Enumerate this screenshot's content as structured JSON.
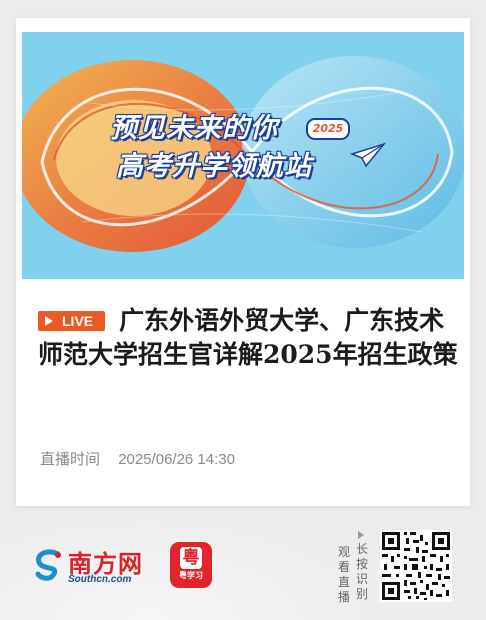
{
  "banner": {
    "line1": "预见未来的你",
    "line2": "高考升学领航站",
    "year": "2025"
  },
  "live": {
    "label": "LIVE"
  },
  "article": {
    "title": "广东外语外贸大学、广东技术师范大学招生官详解2025年招生政策"
  },
  "meta": {
    "label": "直播时间",
    "datetime": "2025/06/26 14:30"
  },
  "footer": {
    "logo_cn": "南方网",
    "logo_en": "Southcn.com",
    "app_name": "粤学习",
    "app_glyph": "粤",
    "qr_hint_col1": "观看直播",
    "qr_hint_col2": "长按识别"
  },
  "icons": {
    "play": "play-triangle-icon",
    "paper_plane": "paper-plane-icon",
    "qr": "qr-code-icon"
  },
  "colors": {
    "accent_orange": "#ea5a24",
    "brand_red": "#d8232a",
    "brand_blue": "#1d4f9c",
    "banner_blue": "#63c6ea"
  }
}
